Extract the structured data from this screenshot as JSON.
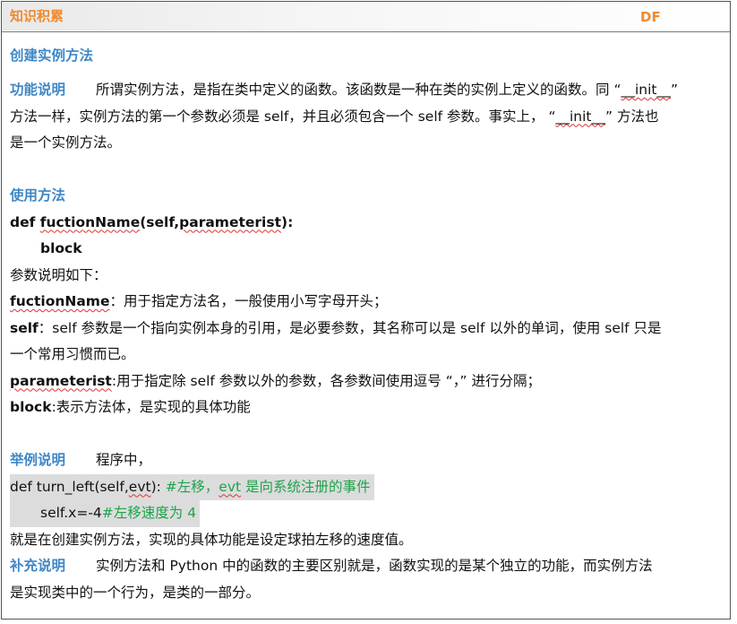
{
  "header": {
    "title": "知识积累",
    "mark": "DF"
  },
  "section_title": "创建实例方法",
  "func_desc": {
    "label": "功能说明",
    "line1_a": "所谓实例方法，是指在类中定义的函数。该函数是一种在类的实例上定义的函数。同 “",
    "init": "__init__",
    "line1_b": "”",
    "line2_a": "方法一样，实例方法的第一个参数必须是 self，并且必须包含一个 self 参数。事实上， “",
    "line2_b": "” 方法也",
    "line3": "是一个实例方法。"
  },
  "usage": {
    "label": "使用方法",
    "code_def": "def ",
    "code_name": "fuctionName",
    "code_open": "(self,",
    "code_param": "parameterist",
    "code_close": "):",
    "code_block": "block",
    "params_intro": "参数说明如下：",
    "p1_name": "fuctionName",
    "p1_text": "：用于指定方法名，一般使用小写字母开头；",
    "p2_name": "self",
    "p2_text_a": "：self 参数是一个指向实例本身的引用，是必要参数，其名称可以是 self 以外的单词，使用 self 只是",
    "p2_text_b": "一个常用习惯而已。",
    "p3_name": "parameterist",
    "p3_text": ":用于指定除 self 参数以外的参数，各参数间使用逗号 “，” 进行分隔；",
    "p4_name": "block",
    "p4_text": ":表示方法体，是实现的具体功能"
  },
  "example": {
    "label": "举例说明",
    "intro": "程序中，",
    "code1_a": "def turn_left(self,",
    "code1_evt": "evt",
    "code1_b": "): ",
    "code1_comment_a": "#左移，",
    "code1_comment_evt": "evt",
    "code1_comment_b": " 是向系统注册的事件",
    "code2_a": "self.x=-4",
    "code2_comment": "#左移速度为 4",
    "after": "就是在创建实例方法，实现的具体功能是设定球拍左移的速度值。"
  },
  "supplement": {
    "label": "补充说明",
    "line1": "实例方法和 Python 中的函数的主要区别就是，函数实现的是某个独立的功能，而实例方法",
    "line2": "是实现类中的一个行为，是类的一部分。"
  }
}
